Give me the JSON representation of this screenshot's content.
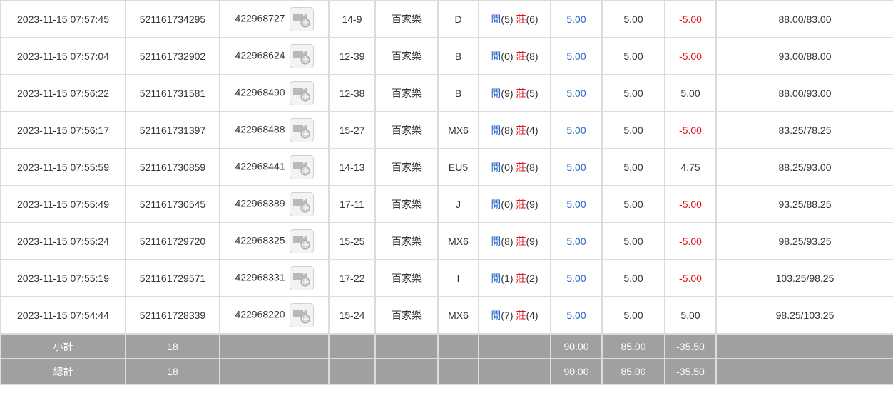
{
  "colors": {
    "player": "#2a67c8",
    "banker": "#e0141e",
    "negative": "#e0141e",
    "footer_bg": "#a0a0a0"
  },
  "icons": {
    "replay": "video-replay-icon"
  },
  "rows": [
    {
      "time": "2023-11-15 07:57:45",
      "bet_id": "521161734295",
      "round_id": "422968727",
      "shoe": "14-9",
      "game": "百家樂",
      "table": "D",
      "player_label": "閒",
      "player_pts": "(5)",
      "banker_label": "莊",
      "banker_pts": "(6)",
      "bet": "5.00",
      "valid": "5.00",
      "win_loss": "-5.00",
      "neg": true,
      "balance": "88.00/83.00"
    },
    {
      "time": "2023-11-15 07:57:04",
      "bet_id": "521161732902",
      "round_id": "422968624",
      "shoe": "12-39",
      "game": "百家樂",
      "table": "B",
      "player_label": "閒",
      "player_pts": "(0)",
      "banker_label": "莊",
      "banker_pts": "(8)",
      "bet": "5.00",
      "valid": "5.00",
      "win_loss": "-5.00",
      "neg": true,
      "balance": "93.00/88.00"
    },
    {
      "time": "2023-11-15 07:56:22",
      "bet_id": "521161731581",
      "round_id": "422968490",
      "shoe": "12-38",
      "game": "百家樂",
      "table": "B",
      "player_label": "閒",
      "player_pts": "(9)",
      "banker_label": "莊",
      "banker_pts": "(5)",
      "bet": "5.00",
      "valid": "5.00",
      "win_loss": "5.00",
      "neg": false,
      "balance": "88.00/93.00"
    },
    {
      "time": "2023-11-15 07:56:17",
      "bet_id": "521161731397",
      "round_id": "422968488",
      "shoe": "15-27",
      "game": "百家樂",
      "table": "MX6",
      "player_label": "閒",
      "player_pts": "(8)",
      "banker_label": "莊",
      "banker_pts": "(4)",
      "bet": "5.00",
      "valid": "5.00",
      "win_loss": "-5.00",
      "neg": true,
      "balance": "83.25/78.25"
    },
    {
      "time": "2023-11-15 07:55:59",
      "bet_id": "521161730859",
      "round_id": "422968441",
      "shoe": "14-13",
      "game": "百家樂",
      "table": "EU5",
      "player_label": "閒",
      "player_pts": "(0)",
      "banker_label": "莊",
      "banker_pts": "(8)",
      "bet": "5.00",
      "valid": "5.00",
      "win_loss": "4.75",
      "neg": false,
      "balance": "88.25/93.00"
    },
    {
      "time": "2023-11-15 07:55:49",
      "bet_id": "521161730545",
      "round_id": "422968389",
      "shoe": "17-11",
      "game": "百家樂",
      "table": "J",
      "player_label": "閒",
      "player_pts": "(0)",
      "banker_label": "莊",
      "banker_pts": "(9)",
      "bet": "5.00",
      "valid": "5.00",
      "win_loss": "-5.00",
      "neg": true,
      "balance": "93.25/88.25"
    },
    {
      "time": "2023-11-15 07:55:24",
      "bet_id": "521161729720",
      "round_id": "422968325",
      "shoe": "15-25",
      "game": "百家樂",
      "table": "MX6",
      "player_label": "閒",
      "player_pts": "(8)",
      "banker_label": "莊",
      "banker_pts": "(9)",
      "bet": "5.00",
      "valid": "5.00",
      "win_loss": "-5.00",
      "neg": true,
      "balance": "98.25/93.25"
    },
    {
      "time": "2023-11-15 07:55:19",
      "bet_id": "521161729571",
      "round_id": "422968331",
      "shoe": "17-22",
      "game": "百家樂",
      "table": "I",
      "player_label": "閒",
      "player_pts": "(1)",
      "banker_label": "莊",
      "banker_pts": "(2)",
      "bet": "5.00",
      "valid": "5.00",
      "win_loss": "-5.00",
      "neg": true,
      "balance": "103.25/98.25"
    },
    {
      "time": "2023-11-15 07:54:44",
      "bet_id": "521161728339",
      "round_id": "422968220",
      "shoe": "15-24",
      "game": "百家樂",
      "table": "MX6",
      "player_label": "閒",
      "player_pts": "(7)",
      "banker_label": "莊",
      "banker_pts": "(4)",
      "bet": "5.00",
      "valid": "5.00",
      "win_loss": "5.00",
      "neg": false,
      "balance": "98.25/103.25"
    }
  ],
  "subtotal": {
    "label": "小計",
    "count": "18",
    "bet": "90.00",
    "valid": "85.00",
    "win_loss": "-35.50"
  },
  "total": {
    "label": "總計",
    "count": "18",
    "bet": "90.00",
    "valid": "85.00",
    "win_loss": "-35.50"
  }
}
